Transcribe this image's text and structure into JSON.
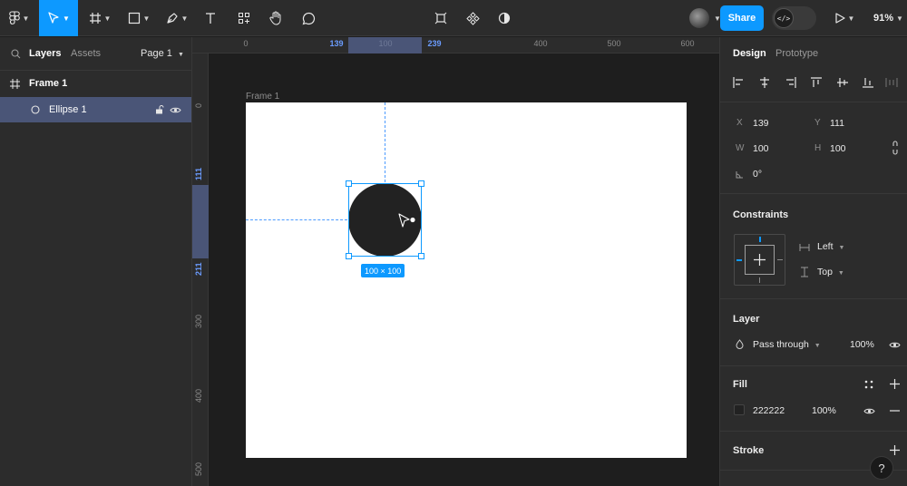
{
  "toolbar": {
    "share_label": "Share",
    "zoom": "91%",
    "dev_mode_icon": "</>",
    "tools": [
      "figma-menu-icon",
      "move-tool-icon",
      "frame-tool-icon",
      "shape-tool-icon",
      "pen-tool-icon",
      "text-tool-icon",
      "resources-icon",
      "hand-tool-icon",
      "comment-icon"
    ],
    "center_tools": [
      "component-icon",
      "boolean-icon",
      "mask-icon"
    ]
  },
  "left_panel": {
    "tab_layers": "Layers",
    "tab_assets": "Assets",
    "page_label": "Page 1",
    "layers": [
      {
        "name": "Frame 1",
        "type": "frame"
      },
      {
        "name": "Ellipse 1",
        "type": "ellipse",
        "selected": true
      }
    ]
  },
  "rulers": {
    "top": [
      "0",
      "100",
      "139",
      "239",
      "400",
      "500",
      "600"
    ],
    "left": [
      "0",
      "111",
      "211",
      "300",
      "400",
      "500"
    ]
  },
  "canvas": {
    "frame_label": "Frame 1",
    "size_badge": "100 × 100",
    "ellipse_color": "#222222",
    "selection_color": "#0d99ff"
  },
  "right_panel": {
    "tab_design": "Design",
    "tab_prototype": "Prototype",
    "x_label": "X",
    "x": "139",
    "y_label": "Y",
    "y": "111",
    "w_label": "W",
    "w": "100",
    "h_label": "H",
    "h": "100",
    "rotation": "0°",
    "constraints_title": "Constraints",
    "constraint_h": "Left",
    "constraint_v": "Top",
    "layer_title": "Layer",
    "blend_mode": "Pass through",
    "layer_opacity": "100%",
    "fill_title": "Fill",
    "fill_hex": "222222",
    "fill_opacity": "100%",
    "stroke_title": "Stroke"
  },
  "help": "?"
}
